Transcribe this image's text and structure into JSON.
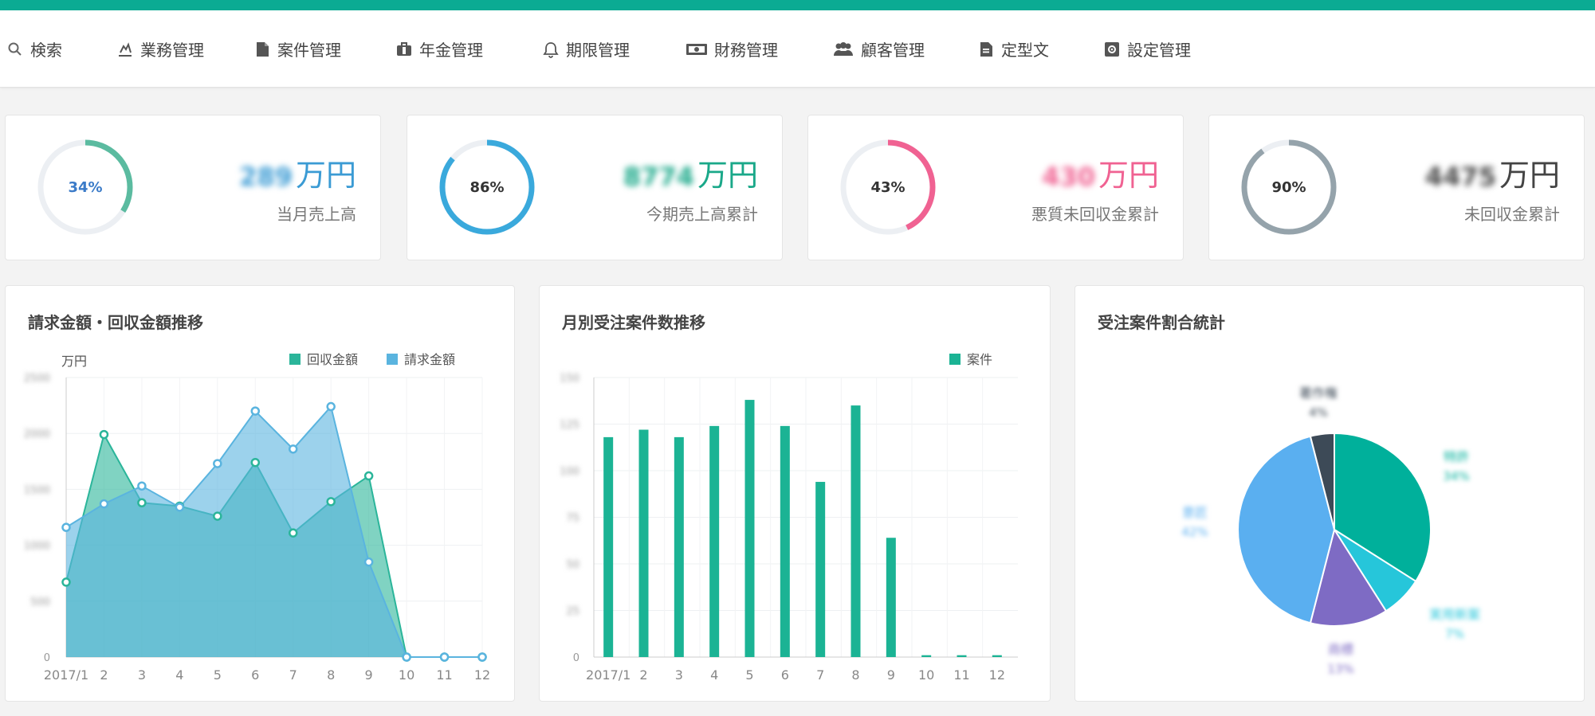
{
  "nav": {
    "items": [
      {
        "label": "検索",
        "icon": "search-icon"
      },
      {
        "label": "業務管理",
        "icon": "tasks-icon"
      },
      {
        "label": "案件管理",
        "icon": "file-icon"
      },
      {
        "label": "年金管理",
        "icon": "briefcase-icon"
      },
      {
        "label": "期限管理",
        "icon": "bell-icon"
      },
      {
        "label": "財務管理",
        "icon": "money-icon"
      },
      {
        "label": "顧客管理",
        "icon": "users-icon"
      },
      {
        "label": "定型文",
        "icon": "document-icon"
      },
      {
        "label": "設定管理",
        "icon": "gear-icon"
      }
    ]
  },
  "kpis": [
    {
      "percent": 34,
      "percent_label": "34%",
      "amount": "289",
      "unit": "万円",
      "label": "当月売上高",
      "color": "#5bbba0",
      "text_color": "#3b9bd4"
    },
    {
      "percent": 86,
      "percent_label": "86%",
      "amount": "8774",
      "unit": "万円",
      "label": "今期売上高累計",
      "color": "#3aa9dc",
      "text_color": "#1aa889"
    },
    {
      "percent": 43,
      "percent_label": "43%",
      "amount": "430",
      "unit": "万円",
      "label": "悪質未回収金累計",
      "color": "#f06292",
      "text_color": "#f06292"
    },
    {
      "percent": 90,
      "percent_label": "90%",
      "amount": "4475",
      "unit": "万円",
      "label": "未回収金累計",
      "color": "#95a3ab",
      "text_color": "#444444"
    }
  ],
  "panels": {
    "area_title": "請求金額・回収金額推移",
    "bar_title": "月別受注案件数推移",
    "pie_title": "受注案件割合統計"
  },
  "chart_data": [
    {
      "type": "area",
      "title": "請求金額・回収金額推移",
      "ylabel": "万円",
      "categories": [
        "2017/1",
        "2",
        "3",
        "4",
        "5",
        "6",
        "7",
        "8",
        "9",
        "10",
        "11",
        "12"
      ],
      "ylim": [
        0,
        2500
      ],
      "yticks": [
        "0",
        "500",
        "1000",
        "1500",
        "2000",
        "2500"
      ],
      "series": [
        {
          "name": "回収金額",
          "color": "#2bb59a",
          "values": [
            670,
            1990,
            1380,
            1350,
            1260,
            1740,
            1110,
            1390,
            1620,
            0,
            0,
            0
          ]
        },
        {
          "name": "請求金額",
          "color": "#5ab4df",
          "values": [
            1160,
            1370,
            1530,
            1340,
            1730,
            2200,
            1860,
            2240,
            850,
            0,
            0,
            0
          ]
        }
      ],
      "legend": "top-right",
      "grid": true
    },
    {
      "type": "bar",
      "title": "月別受注案件数推移",
      "categories": [
        "2017/1",
        "2",
        "3",
        "4",
        "5",
        "6",
        "7",
        "8",
        "9",
        "10",
        "11",
        "12"
      ],
      "ylim": [
        0,
        150
      ],
      "yticks": [
        "0",
        "25",
        "50",
        "75",
        "100",
        "125",
        "150"
      ],
      "series": [
        {
          "name": "案件",
          "color": "#1bb394",
          "values": [
            118,
            122,
            118,
            124,
            138,
            124,
            94,
            135,
            64,
            1,
            1,
            1
          ]
        }
      ],
      "legend": "top-right",
      "grid": true
    },
    {
      "type": "pie",
      "title": "受注案件割合統計",
      "slices": [
        {
          "name": "特許",
          "value": 34,
          "label": "34%",
          "color": "#00b09b"
        },
        {
          "name": "実用新案",
          "value": 7,
          "label": "7%",
          "color": "#26c6da"
        },
        {
          "name": "商標",
          "value": 13,
          "label": "13%",
          "color": "#7e6bc4"
        },
        {
          "name": "意匠",
          "value": 42,
          "label": "42%",
          "color": "#5aaff0"
        },
        {
          "name": "著作権",
          "value": 4,
          "label": "4%",
          "color": "#3d4a57"
        }
      ]
    }
  ]
}
